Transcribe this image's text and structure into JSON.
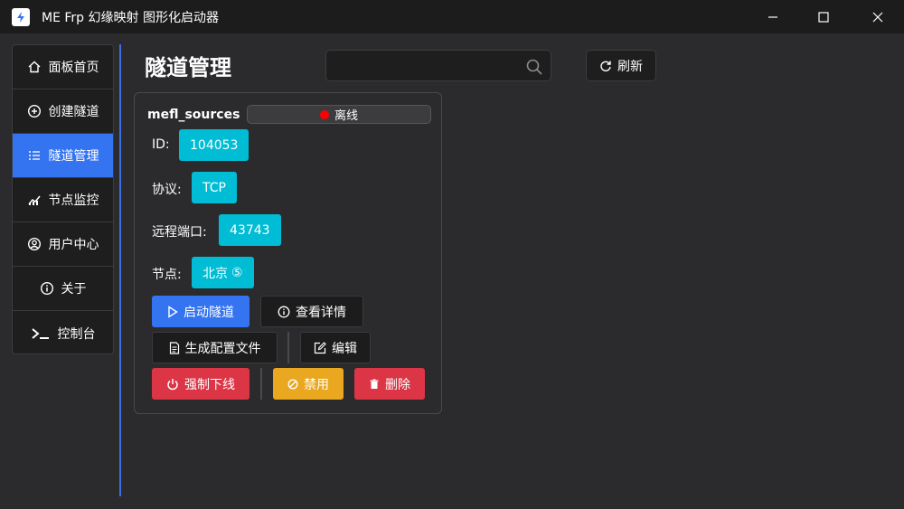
{
  "window": {
    "title": "ME Frp 幻缘映射 图形化启动器",
    "app_icon": "lightning-bolt-icon"
  },
  "sidebar": {
    "items": [
      {
        "label": "面板首页",
        "icon": "home-icon",
        "active": false
      },
      {
        "label": "创建隧道",
        "icon": "plus-circle-icon",
        "active": false
      },
      {
        "label": "隧道管理",
        "icon": "list-icon",
        "active": true
      },
      {
        "label": "节点监控",
        "icon": "chart-icon",
        "active": false
      },
      {
        "label": "用户中心",
        "icon": "user-circle-icon",
        "active": false
      },
      {
        "label": "关于",
        "icon": "info-icon",
        "active": false
      },
      {
        "label": "控制台",
        "icon": "terminal-icon",
        "active": false
      }
    ]
  },
  "main": {
    "title": "隧道管理",
    "search": {
      "value": "",
      "placeholder": ""
    },
    "refresh_label": "刷新"
  },
  "tunnel": {
    "name": "mefl_sources",
    "status": "离线",
    "id_label": "ID:",
    "id_value": "104053",
    "protocol_label": "协议:",
    "protocol_value": "TCP",
    "remote_port_label": "远程端口:",
    "remote_port_value": "43743",
    "node_label": "节点:",
    "node_value": "北京",
    "node_badge": "⑤",
    "actions": {
      "start": "启动隧道",
      "details": "查看详情",
      "gen_config": "生成配置文件",
      "edit": "编辑",
      "force_offline": "强制下线",
      "disable": "禁用",
      "delete": "删除"
    }
  },
  "colors": {
    "accent": "#3574f0",
    "tag": "#00bcd4",
    "danger": "#dc3545",
    "warning": "#e9a820",
    "offline_dot": "#ff0000"
  }
}
